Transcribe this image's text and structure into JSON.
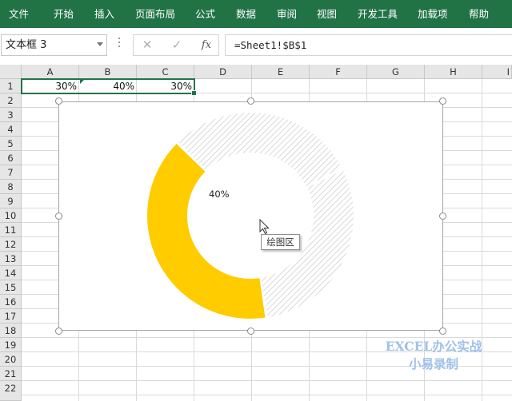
{
  "ribbon": {
    "accent": "#217346",
    "tabs": [
      "文件",
      "开始",
      "插入",
      "页面布局",
      "公式",
      "数据",
      "审阅",
      "视图",
      "开发工具",
      "加载项",
      "帮助"
    ]
  },
  "formula_bar": {
    "name_box": "文本框 3",
    "cancel_icon": "cancel-x-icon",
    "enter_icon": "checkmark-icon",
    "fx_label": "fx",
    "formula": "=Sheet1!$B$1"
  },
  "sheet": {
    "columns": [
      "A",
      "B",
      "C",
      "D",
      "E",
      "F",
      "G",
      "H",
      "I"
    ],
    "rows": [
      "1",
      "2",
      "3",
      "4",
      "5",
      "6",
      "7",
      "8",
      "9",
      "10",
      "11",
      "12",
      "13",
      "14",
      "15",
      "16",
      "17",
      "18",
      "19",
      "20",
      "21",
      "22"
    ],
    "row1": {
      "A": "30%",
      "B": "40%",
      "C": "30%"
    }
  },
  "chart_data": {
    "type": "pie",
    "style": "doughnut",
    "slices": [
      {
        "value": 30,
        "fill": "hatched-gray"
      },
      {
        "value": 40,
        "fill": "#ffcc00"
      },
      {
        "value": 30,
        "fill": "hatched-gray"
      }
    ],
    "data_label": "40%",
    "highlight_color": "#ffcc00",
    "tooltip": "绘图区"
  },
  "watermark": {
    "line1": "EXCEL办公实战",
    "line2": "小易录制"
  }
}
